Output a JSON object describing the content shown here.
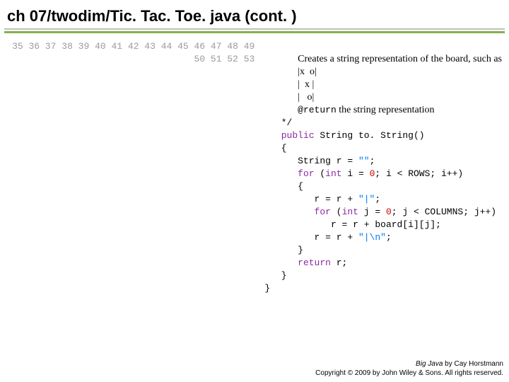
{
  "title": "ch 07/twodim/Tic. Tac. Toe. java (cont. )",
  "line_start": 35,
  "line_end": 53,
  "code": {
    "l35": "Creates a string representation of the board, such as",
    "l36": "|x  o|",
    "l37": "|  x |",
    "l38": "|   o|",
    "l39_a": "@return",
    "l39_b": " the string representation",
    "l40": "   */",
    "l41_a": "   ",
    "l41_kw": "public",
    "l41_b": " String to. String()",
    "l42": "   {",
    "l43_a": "      String r = ",
    "l43_str": "\"\"",
    "l43_b": ";",
    "l44_a": "      ",
    "l44_for": "for",
    "l44_b": " (",
    "l44_int": "int",
    "l44_c": " i = ",
    "l44_n1": "0",
    "l44_d": "; i < ROWS; i++)",
    "l45": "      {",
    "l46_a": "         r = r + ",
    "l46_str": "\"|\"",
    "l46_b": ";",
    "l47_a": "         ",
    "l47_for": "for",
    "l47_b": " (",
    "l47_int": "int",
    "l47_c": " j = ",
    "l47_n1": "0",
    "l47_d": "; j < COLUMNS; j++)",
    "l48": "            r = r + board[i][j];",
    "l49_a": "         r = r + ",
    "l49_str": "\"|\\n\"",
    "l49_b": ";",
    "l50": "      }",
    "l51_a": "      ",
    "l51_kw": "return",
    "l51_b": " r;",
    "l52": "   }",
    "l53": "}"
  },
  "footer": {
    "line1a": "Big Java",
    "line1b": " by Cay Horstmann",
    "line2": "Copyright © 2009 by John Wiley & Sons.  All rights reserved."
  }
}
